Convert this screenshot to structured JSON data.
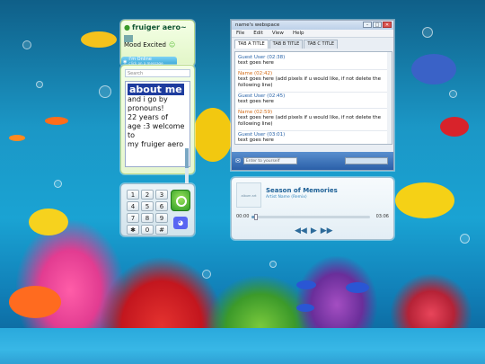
{
  "status": {
    "name": "fruiger aero~",
    "mood": "Mood Excited",
    "online": "I'm Online",
    "online_sub": "click on a message"
  },
  "about": {
    "search_placeholder": "Search",
    "title": "about me",
    "lines": [
      "and i go by",
      "pronouns!",
      "22 years of",
      "age :3 welcome to",
      "my fruiger aero"
    ],
    "scroll_fraction": 0.25
  },
  "dialpad": {
    "keys": [
      "1",
      "2",
      "3",
      "4",
      "5",
      "6",
      "7",
      "8",
      "9",
      "✱",
      "0",
      "#"
    ]
  },
  "webpage": {
    "title": "name's webspace",
    "menu": [
      "File",
      "Edit",
      "View",
      "Help"
    ],
    "tabs": [
      "TAB A TITLE",
      "TAB B TITLE",
      "TAB C TITLE"
    ],
    "entries": [
      {
        "head": "Guest User (02:38)",
        "text": "text goes here",
        "color": "blue"
      },
      {
        "head": "Name (02:42)",
        "text": "text goes here (add pixels if u would like, if not delete the following line)",
        "color": "orange"
      },
      {
        "head": "Guest User (02:45)",
        "text": "text goes here",
        "color": "blue"
      },
      {
        "head": "Name (02:59)",
        "text": "text goes here (add pixels if u would like, if not delete the following line)",
        "color": "orange"
      },
      {
        "head": "Guest User (03:01)",
        "text": "text goes here",
        "color": "blue"
      }
    ],
    "footer_placeholder": "Enter to yourself"
  },
  "player": {
    "album_label": "album art",
    "song": "Season of Memories",
    "artist": "Artist Name (Remix)",
    "time_current": "00:00",
    "time_total": "03:06",
    "progress": 0.04
  },
  "colors": {
    "accent": "#2a7fc4",
    "status_bg": "#e2f6c7",
    "about_title_bg": "#1e3c9e"
  }
}
